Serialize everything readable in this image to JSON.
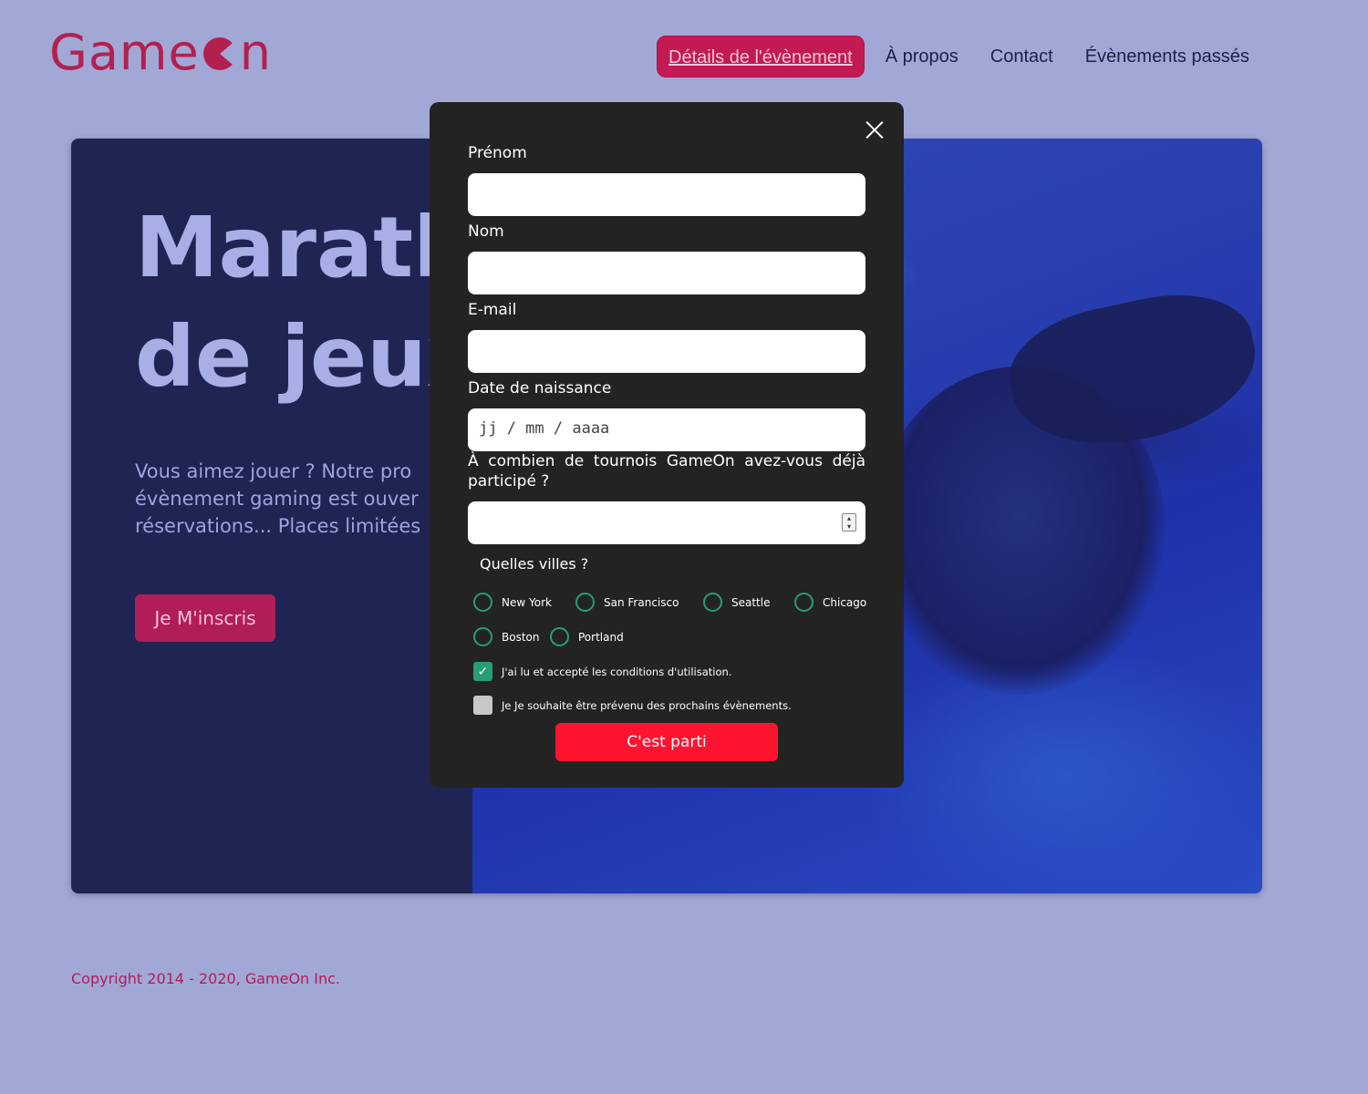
{
  "header": {
    "logo_part1": "Game",
    "logo_part2": "n",
    "nav": [
      {
        "label": "Détails de l'évènement",
        "active": true
      },
      {
        "label": "À propos"
      },
      {
        "label": "Contact"
      },
      {
        "label": "Évènements passés"
      }
    ]
  },
  "hero": {
    "title_line1": "Marath",
    "title_line2": "de jeux",
    "text_line1": "Vous aimez jouer ? Notre pro",
    "text_line2": "évènement gaming est ouver",
    "text_line3": "réservations... Places limitées",
    "cta_label": "Je M'inscris"
  },
  "footer": {
    "copyright": "Copyright 2014 - 2020, GameOn Inc."
  },
  "modal": {
    "first_name_label": "Prénom",
    "last_name_label": "Nom",
    "email_label": "E-mail",
    "birthdate_label": "Date de naissance",
    "birthdate_placeholder": "jj / mm / aaaa",
    "tournaments_question": "À combien de tournois GameOn avez-vous déjà participé ?",
    "cities_label": "Quelles villes ?",
    "cities": [
      "New York",
      "San Francisco",
      "Seattle",
      "Chicago",
      "Boston",
      "Portland"
    ],
    "terms_label": "J'ai lu et accepté les conditions d'utilisation.",
    "terms_checked": true,
    "newsletter_label": "Je Je souhaite être prévenu des prochains évènements.",
    "newsletter_checked": false,
    "submit_label": "C'est parti"
  },
  "colors": {
    "background": "#a2a8d6",
    "brand": "#b3204f",
    "modal_bg": "#232323",
    "submit": "#fe142f",
    "radio_accent": "#279e73"
  }
}
